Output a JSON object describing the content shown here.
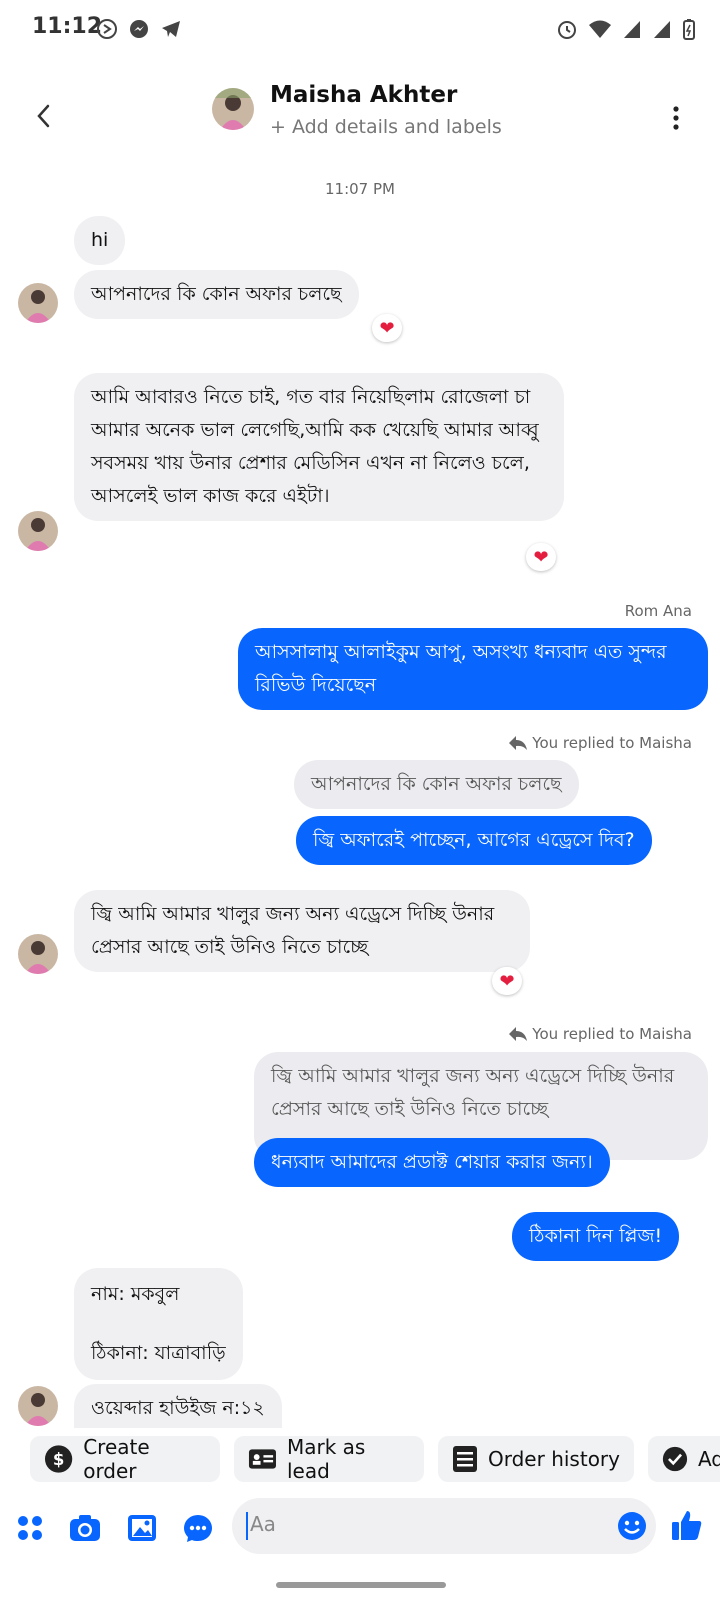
{
  "status": {
    "time": "11:12"
  },
  "header": {
    "name": "Maisha Akhter",
    "subtitle": "+ Add details and labels"
  },
  "timestamp": "11:07 PM",
  "messages": {
    "m1": "hi",
    "m2": "আপনাদের কি কোন অফার চলছে",
    "m3": "আমি আবারও নিতে চাই, গত বার নিয়েছিলাম রোজেলা চা আমার অনেক ভাল লেগেছি,আমি কক খেয়েছি আমার আব্বু সবসময় খায় উনার প্রেশার মেডিসিন এখন না নিলেও চলে, আসলেই ভাল কাজ করে এইটা।",
    "sender_label": "Rom Ana",
    "m4": "আসসালামু আলাইকুম আপু, অসংখ্য ধন্যবাদ এত সুন্দর রিভিউ দিয়েছেন",
    "reply_label_1": "You replied to Maisha",
    "quote1": "আপনাদের কি কোন অফার চলছে",
    "m5": "জ্বি অফারেই পাচ্ছেন, আগের এড্রেসে দিব?",
    "m6": "জ্বি আমি আমার খালুর জন্য অন্য এড্রেসে দিচ্ছি উনার প্রেসার আছে তাই উনিও নিতে চাচ্ছে",
    "reply_label_2": "You replied to Maisha",
    "quote2": "জ্বি আমি আমার খালুর জন্য অন্য এড্রেসে দিচ্ছি উনার প্রেসার আছে তাই উনিও নিতে চাচ্ছে",
    "m7": "ধন্যবাদ আমাদের প্রডাক্ট শেয়ার করার জন্য।",
    "m8": "ঠিকানা দিন প্লিজ!",
    "m9_line1": "নাম: মকবুল",
    "m9_line2": "ঠিকানা: যাত্রাবাড়ি",
    "m10": "ওয়েব্দার হাউইজ ন:১২"
  },
  "reactions": {
    "heart": "❤"
  },
  "quick_actions": [
    {
      "label": "Create order",
      "icon": "dollar-icon"
    },
    {
      "label": "Mark as lead",
      "icon": "contact-card-icon"
    },
    {
      "label": "Order history",
      "icon": "list-icon"
    },
    {
      "label": "Ad",
      "icon": "check-circle-icon"
    }
  ],
  "composer": {
    "placeholder": "Aa"
  },
  "colors": {
    "accent": "#0866ff",
    "incoming_bubble": "#f0f0f2",
    "reaction_heart": "#e41e3f"
  }
}
